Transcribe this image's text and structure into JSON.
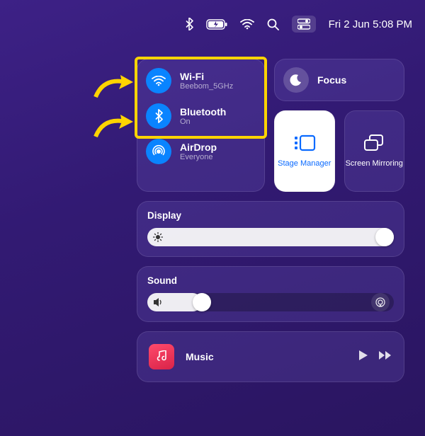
{
  "menubar": {
    "date_time": "Fri 2 Jun  5:08 PM"
  },
  "connectivity": {
    "wifi": {
      "title": "Wi-Fi",
      "subtitle": "Beebom_5GHz"
    },
    "bluetooth": {
      "title": "Bluetooth",
      "subtitle": "On"
    },
    "airdrop": {
      "title": "AirDrop",
      "subtitle": "Everyone"
    }
  },
  "focus": {
    "label": "Focus"
  },
  "stage_manager": {
    "label": "Stage Manager"
  },
  "screen_mirroring": {
    "label": "Screen Mirroring"
  },
  "display": {
    "title": "Display",
    "value_pct": 100
  },
  "sound": {
    "title": "Sound",
    "value_pct": 22
  },
  "music": {
    "label": "Music"
  },
  "colors": {
    "accent_blue": "#0a84ff",
    "highlight_yellow": "#ffd400"
  }
}
